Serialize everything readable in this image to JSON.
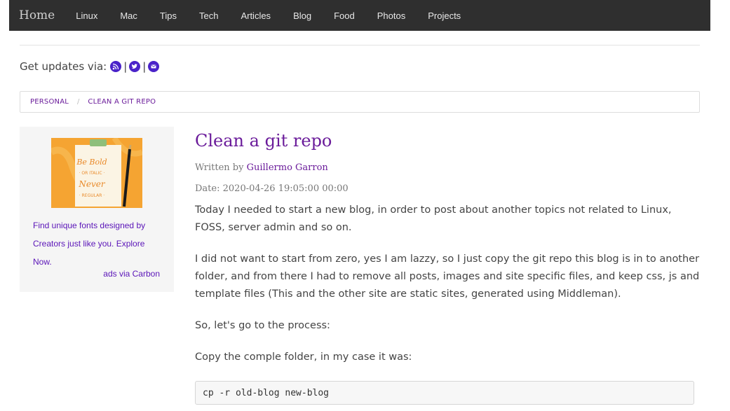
{
  "nav": {
    "brand": "Home",
    "links": [
      "Linux",
      "Mac",
      "Tips",
      "Tech",
      "Articles",
      "Blog",
      "Food",
      "Photos",
      "Projects"
    ]
  },
  "updates": {
    "label": "Get updates via:",
    "icons": [
      "rss-icon",
      "twitter-icon",
      "email-icon"
    ],
    "separator": "|"
  },
  "breadcrumb": {
    "items": [
      "Personal",
      "Clean a git repo"
    ],
    "separator": "/"
  },
  "ad": {
    "image_label": "Be Bold or Italic Never Regular",
    "text": "Find unique fonts designed by Creators just like you. Explore Now.",
    "via": "ads via Carbon"
  },
  "post": {
    "title": "Clean a git repo",
    "written_by_label": "Written by",
    "author": "Guillermo Garron",
    "date_label": "Date:",
    "date": "2020-04-26 19:05:00 00:00",
    "paragraphs": [
      "Today I needed to start a new blog, in order to post about another topics not related to Linux, FOSS, server admin and so on.",
      "I did not want to start from zero, yes I am lazzy, so I just copy the git repo this blog is in to another folder, and from there I had to remove all posts, images and site specific files, and keep css, js and template files (This and the other site are static sites, generated using Middleman).",
      "So, let's go to the process:",
      "Copy the comple folder, in my case it was:"
    ],
    "code": "cp -r old-blog new-blog"
  },
  "colors": {
    "navbar_bg": "#2f2f2f",
    "accent_purple": "#6a1b9a",
    "icon_blue": "#4a23c9",
    "ad_orange": "#f7a93a"
  }
}
